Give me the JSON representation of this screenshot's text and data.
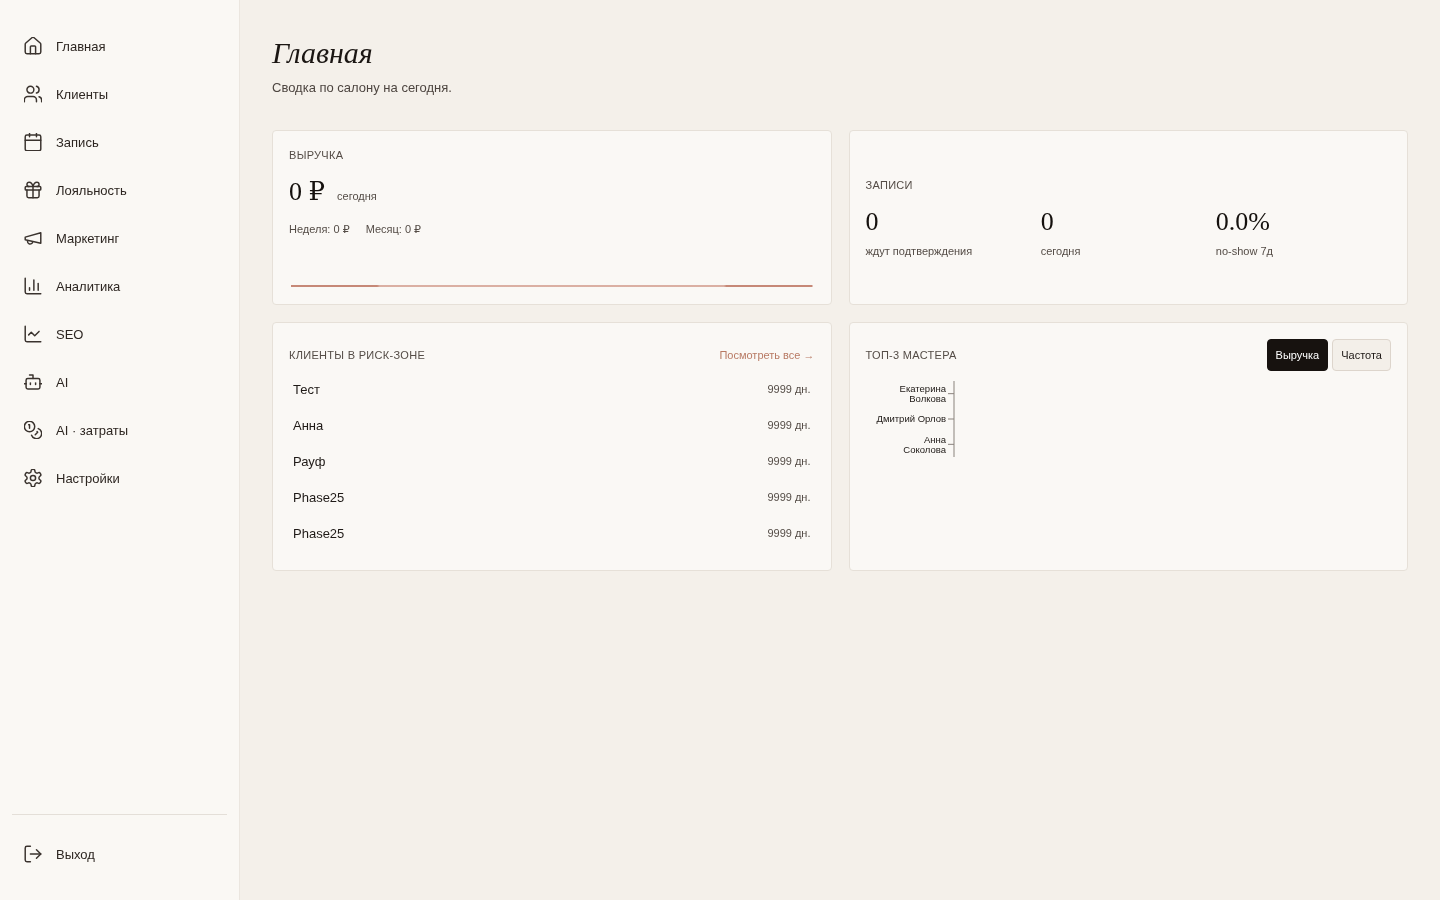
{
  "sidebar": {
    "items": [
      {
        "label": "Главная"
      },
      {
        "label": "Клиенты"
      },
      {
        "label": "Запись"
      },
      {
        "label": "Лояльность"
      },
      {
        "label": "Маркетинг"
      },
      {
        "label": "Аналитика"
      },
      {
        "label": "SEO"
      },
      {
        "label": "AI"
      },
      {
        "label": "AI · затраты"
      },
      {
        "label": "Настройки"
      }
    ],
    "logout": {
      "label": "Выход"
    }
  },
  "header": {
    "title": "Главная",
    "subtitle": "Сводка по салону на сегодня."
  },
  "revenue_card": {
    "title": "ВЫРУЧКА",
    "value": "0 ₽",
    "value_caption": "сегодня",
    "periods": [
      "Неделя: 0 ₽",
      "Месяц: 0 ₽"
    ]
  },
  "bookings_card": {
    "title": "ЗАПИСИ",
    "stats": [
      {
        "value": "0",
        "label": "ждут подтверждения"
      },
      {
        "value": "0",
        "label": "сегодня"
      },
      {
        "value": "0.0%",
        "label": "no-show 7д"
      }
    ]
  },
  "risk_clients_card": {
    "title": "КЛИЕНТЫ В РИСК-ЗОНЕ",
    "link": "Посмотреть все →",
    "rows": [
      {
        "name": "Тест",
        "days": "9999 дн."
      },
      {
        "name": "Анна",
        "days": "9999 дн."
      },
      {
        "name": "Рауф",
        "days": "9999 дн."
      },
      {
        "name": "Phase25",
        "days": "9999 дн."
      },
      {
        "name": "Phase25",
        "days": "9999 дн."
      }
    ]
  },
  "top_masters_card": {
    "title": "ТОП-3 МАСТЕРА",
    "toggle": [
      {
        "label": "Выручка",
        "selected": true
      },
      {
        "label": "Частота",
        "selected": false
      }
    ],
    "axis_labels": [
      "Екатерина\nВолкова",
      "Дмитрий Орлов",
      "Анна\nСоколова"
    ]
  }
}
